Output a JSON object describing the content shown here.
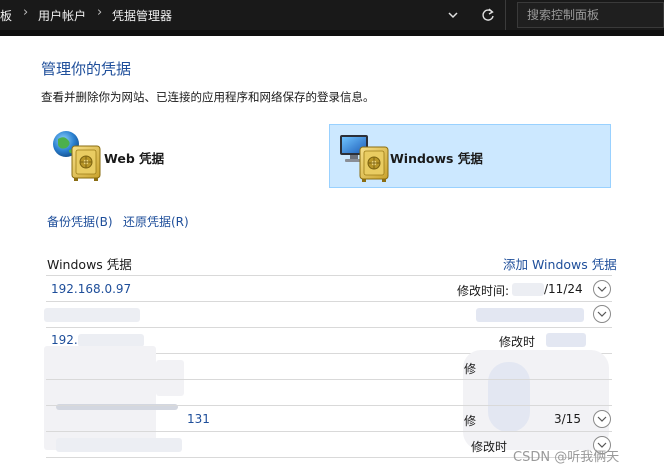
{
  "breadcrumb": {
    "items": [
      "板",
      "用户帐户",
      "凭据管理器"
    ]
  },
  "search": {
    "placeholder": "搜索控制面板"
  },
  "page": {
    "title": "管理你的凭据",
    "description": "查看并删除你为网站、已连接的应用程序和网络保存的登录信息。"
  },
  "tiles": {
    "web": {
      "label": "Web 凭据",
      "selected": false
    },
    "windows": {
      "label": "Windows 凭据",
      "selected": true
    }
  },
  "actions": {
    "backup": "备份凭据(B)",
    "restore": "还原凭据(R)"
  },
  "section": {
    "title": "Windows 凭据",
    "add_link": "添加 Windows 凭据"
  },
  "credentials": [
    {
      "name": "192.168.0.97",
      "modified_label": "修改时间:",
      "modified_value": "/11/24"
    },
    {
      "name": "",
      "modified_label": "",
      "modified_value": ""
    },
    {
      "name": "192.",
      "modified_label": "修改时",
      "modified_value": ""
    },
    {
      "name": "",
      "modified_label": "修",
      "modified_value": ""
    },
    {
      "name": "131",
      "modified_label": "修",
      "modified_value": "3/15"
    },
    {
      "name": "",
      "modified_label": "修改时",
      "modified_value": ""
    }
  ],
  "watermark": "CSDN @听我俩天",
  "colors": {
    "link_blue": "#1e4e9a",
    "selected_tile_bg": "#cce8ff",
    "selected_tile_border": "#99d1ff",
    "topbar_bg": "#191919"
  }
}
